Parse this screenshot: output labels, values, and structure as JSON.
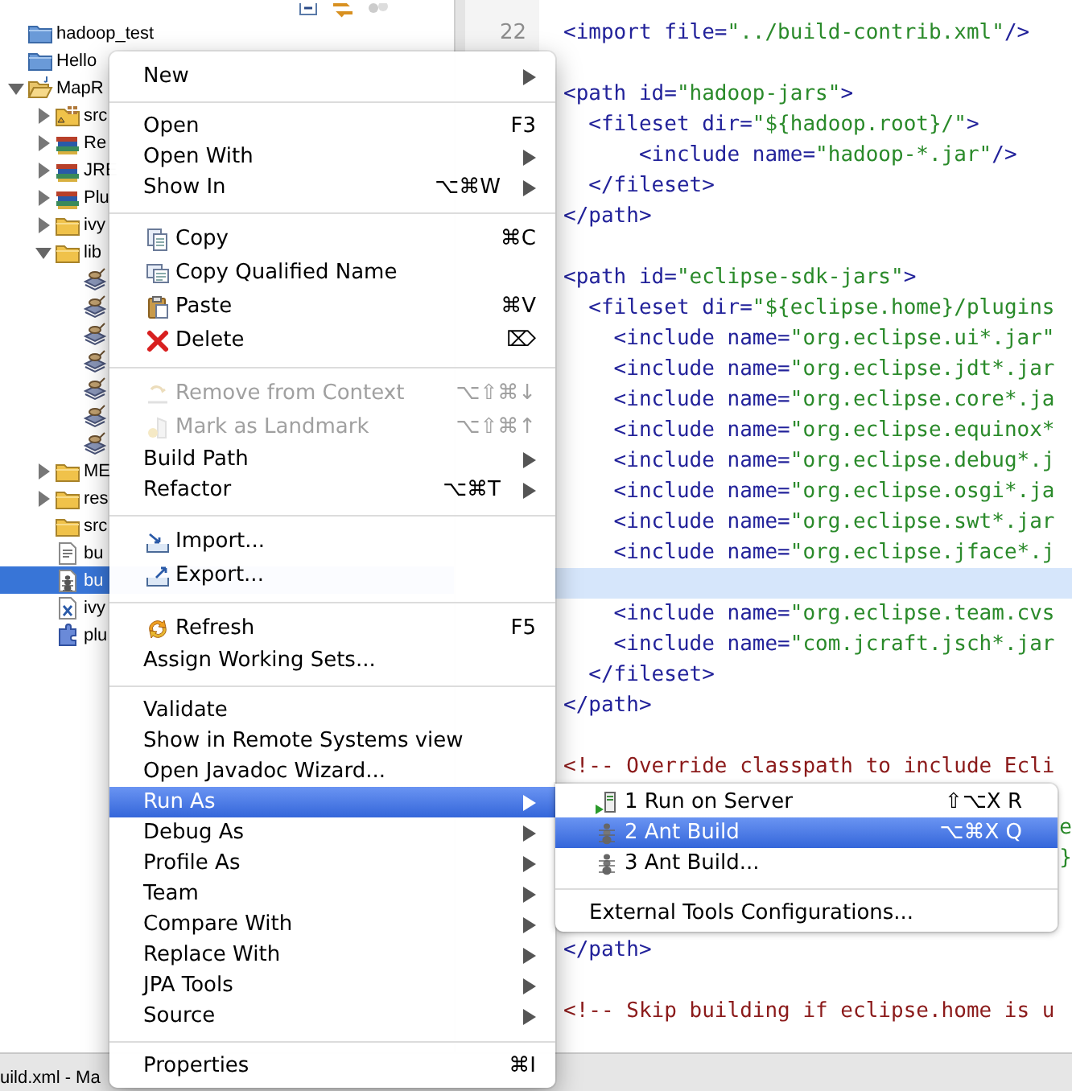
{
  "explorer": {
    "items": [
      {
        "label": "hadoop_test",
        "kind": "project",
        "selected": false
      },
      {
        "label": "Hello",
        "kind": "project",
        "selected": false
      },
      {
        "label": "MapR",
        "kind": "project-open",
        "expanded": true,
        "selected": false,
        "children": [
          {
            "label": "src",
            "kind": "source-folder",
            "expanded": false,
            "selected": false
          },
          {
            "label": "Re",
            "kind": "library",
            "expanded": false,
            "selected": false
          },
          {
            "label": "JRE",
            "kind": "library",
            "expanded": false,
            "selected": false
          },
          {
            "label": "Plu",
            "kind": "library",
            "expanded": false,
            "selected": false
          },
          {
            "label": "ivy",
            "kind": "folder",
            "expanded": false,
            "selected": false
          },
          {
            "label": "lib",
            "kind": "folder",
            "expanded": true,
            "selected": false,
            "children": [
              {
                "kind": "jar",
                "selected": false
              },
              {
                "kind": "jar",
                "selected": false
              },
              {
                "kind": "jar",
                "selected": false
              },
              {
                "kind": "jar",
                "selected": false
              },
              {
                "kind": "jar",
                "selected": false
              },
              {
                "kind": "jar",
                "selected": false
              },
              {
                "kind": "jar",
                "selected": false
              }
            ]
          },
          {
            "label": "ME",
            "kind": "folder",
            "expanded": false,
            "selected": false
          },
          {
            "label": "res",
            "kind": "folder",
            "expanded": false,
            "selected": false
          },
          {
            "label": "src",
            "kind": "folder",
            "selected": false
          },
          {
            "label": "bu",
            "kind": "properties-file",
            "selected": false
          },
          {
            "label": "bu",
            "kind": "ant-file",
            "selected": true
          },
          {
            "label": "ivy",
            "kind": "xml-file",
            "selected": false
          },
          {
            "label": "plu",
            "kind": "plugin-file",
            "selected": false
          }
        ]
      }
    ]
  },
  "editor": {
    "lines": [
      {
        "number": "22",
        "kind": "code",
        "text": "<import file=\"../build-contrib.xml\"/>",
        "current": false
      },
      {
        "kind": "blank",
        "current": false
      },
      {
        "kind": "code",
        "text": "<path id=\"hadoop-jars\">",
        "current": false
      },
      {
        "kind": "code",
        "text": "  <fileset dir=\"${hadoop.root}/\">",
        "current": false
      },
      {
        "kind": "code",
        "text": "      <include name=\"hadoop-*.jar\"/>",
        "current": false
      },
      {
        "kind": "code",
        "text": "  </fileset>",
        "current": false
      },
      {
        "kind": "code",
        "text": "</path>",
        "current": false
      },
      {
        "kind": "blank",
        "current": false
      },
      {
        "kind": "code",
        "text": "<path id=\"eclipse-sdk-jars\">",
        "current": false
      },
      {
        "kind": "code",
        "text": "  <fileset dir=\"${eclipse.home}/plugins",
        "current": false
      },
      {
        "kind": "code",
        "text": "    <include name=\"org.eclipse.ui*.jar\"",
        "current": false
      },
      {
        "kind": "code",
        "text": "    <include name=\"org.eclipse.jdt*.jar",
        "current": false
      },
      {
        "kind": "code",
        "text": "    <include name=\"org.eclipse.core*.ja",
        "current": false
      },
      {
        "kind": "code",
        "text": "    <include name=\"org.eclipse.equinox*",
        "current": false
      },
      {
        "kind": "code",
        "text": "    <include name=\"org.eclipse.debug*.j",
        "current": false
      },
      {
        "kind": "code",
        "text": "    <include name=\"org.eclipse.osgi*.ja",
        "current": false
      },
      {
        "kind": "code",
        "text": "    <include name=\"org.eclipse.swt*.jar",
        "current": false
      },
      {
        "kind": "code",
        "text": "    <include name=\"org.eclipse.jface*.j",
        "current": false
      },
      {
        "kind": "blank",
        "current": true
      },
      {
        "kind": "code",
        "text": "    <include name=\"org.eclipse.team.cvs",
        "current": false
      },
      {
        "kind": "code",
        "text": "    <include name=\"com.jcraft.jsch*.jar",
        "current": false
      },
      {
        "kind": "code",
        "text": "  </fileset>",
        "current": false
      },
      {
        "kind": "code",
        "text": "</path>",
        "current": false
      },
      {
        "kind": "blank",
        "current": false
      },
      {
        "kind": "comment",
        "text": "<!-- Override classpath to include Ecli",
        "current": false
      },
      {
        "kind": "blank",
        "current": false
      },
      {
        "kind": "fragment",
        "text": "e",
        "current": false
      },
      {
        "kind": "fragment",
        "text": "}",
        "current": false
      },
      {
        "kind": "blank",
        "current": false
      },
      {
        "kind": "blank",
        "current": false
      },
      {
        "kind": "code",
        "text": "</path>",
        "current": false
      },
      {
        "kind": "blank",
        "current": false
      },
      {
        "kind": "comment",
        "text": "<!-- Skip building if eclipse.home is u",
        "current": false
      }
    ]
  },
  "status_bar": {
    "text": "uild.xml - Ma"
  },
  "context_menu": {
    "sections": [
      [
        {
          "label": "New",
          "kind": "plain",
          "submenu": true,
          "disabled": false,
          "selected": false
        }
      ],
      [
        {
          "label": "Open",
          "kind": "plain",
          "shortcut": "F3",
          "submenu": false,
          "disabled": false,
          "selected": false
        },
        {
          "label": "Open With",
          "kind": "plain",
          "submenu": true,
          "disabled": false,
          "selected": false
        },
        {
          "label": "Show In",
          "kind": "plain",
          "shortcut": "⌥⌘W",
          "submenu": true,
          "disabled": false,
          "selected": false
        }
      ],
      [
        {
          "label": "Copy",
          "kind": "copy",
          "shortcut": "⌘C",
          "submenu": false,
          "disabled": false,
          "selected": false
        },
        {
          "label": "Copy Qualified Name",
          "kind": "copy-name",
          "submenu": false,
          "disabled": false,
          "selected": false
        },
        {
          "label": "Paste",
          "kind": "paste",
          "shortcut": "⌘V",
          "submenu": false,
          "disabled": false,
          "selected": false
        },
        {
          "label": "Delete",
          "kind": "delete",
          "shortcut": "⌦",
          "submenu": false,
          "disabled": false,
          "selected": false
        }
      ],
      [
        {
          "label": "Remove from Context",
          "kind": "remove-context",
          "shortcut": "⌥⇧⌘↓",
          "submenu": false,
          "disabled": true,
          "selected": false
        },
        {
          "label": "Mark as Landmark",
          "kind": "landmark",
          "shortcut": "⌥⇧⌘↑",
          "submenu": false,
          "disabled": true,
          "selected": false
        },
        {
          "label": "Build Path",
          "kind": "plain",
          "submenu": true,
          "disabled": false,
          "selected": false
        },
        {
          "label": "Refactor",
          "kind": "plain",
          "shortcut": "⌥⌘T",
          "submenu": true,
          "disabled": false,
          "selected": false
        }
      ],
      [
        {
          "label": "Import...",
          "kind": "import",
          "submenu": false,
          "disabled": false,
          "selected": false
        },
        {
          "label": "Export...",
          "kind": "export",
          "submenu": false,
          "disabled": false,
          "selected": false
        }
      ],
      [
        {
          "label": "Refresh",
          "kind": "refresh",
          "shortcut": "F5",
          "submenu": false,
          "disabled": false,
          "selected": false
        },
        {
          "label": "Assign Working Sets...",
          "kind": "plain",
          "submenu": false,
          "disabled": false,
          "selected": false
        }
      ],
      [
        {
          "label": "Validate",
          "kind": "plain",
          "submenu": false,
          "disabled": false,
          "selected": false
        },
        {
          "label": "Show in Remote Systems view",
          "kind": "plain",
          "submenu": false,
          "disabled": false,
          "selected": false
        },
        {
          "label": "Open Javadoc Wizard...",
          "kind": "plain",
          "submenu": false,
          "disabled": false,
          "selected": false
        },
        {
          "label": "Run As",
          "kind": "plain",
          "submenu": true,
          "disabled": false,
          "selected": true
        },
        {
          "label": "Debug As",
          "kind": "plain",
          "submenu": true,
          "disabled": false,
          "selected": false
        },
        {
          "label": "Profile As",
          "kind": "plain",
          "submenu": true,
          "disabled": false,
          "selected": false
        },
        {
          "label": "Team",
          "kind": "plain",
          "submenu": true,
          "disabled": false,
          "selected": false
        },
        {
          "label": "Compare With",
          "kind": "plain",
          "submenu": true,
          "disabled": false,
          "selected": false
        },
        {
          "label": "Replace With",
          "kind": "plain",
          "submenu": true,
          "disabled": false,
          "selected": false
        },
        {
          "label": "JPA Tools",
          "kind": "plain",
          "submenu": true,
          "disabled": false,
          "selected": false
        },
        {
          "label": "Source",
          "kind": "plain",
          "submenu": true,
          "disabled": false,
          "selected": false
        }
      ],
      [
        {
          "label": "Properties",
          "kind": "plain",
          "shortcut": "⌘I",
          "submenu": false,
          "disabled": false,
          "selected": false
        }
      ]
    ]
  },
  "run_as_menu": {
    "sections": [
      [
        {
          "label": "1 Run on Server",
          "kind": "run-server",
          "shortcut": "⇧⌥X R",
          "submenu": false,
          "disabled": false,
          "selected": false
        },
        {
          "label": "2 Ant Build",
          "kind": "ant",
          "shortcut": "⌥⌘X Q",
          "submenu": false,
          "disabled": false,
          "selected": true
        },
        {
          "label": "3 Ant Build...",
          "kind": "ant",
          "submenu": false,
          "disabled": false,
          "selected": false
        }
      ],
      [
        {
          "label": "External Tools Configurations...",
          "kind": "plain",
          "submenu": false,
          "disabled": false,
          "selected": false
        }
      ]
    ]
  }
}
